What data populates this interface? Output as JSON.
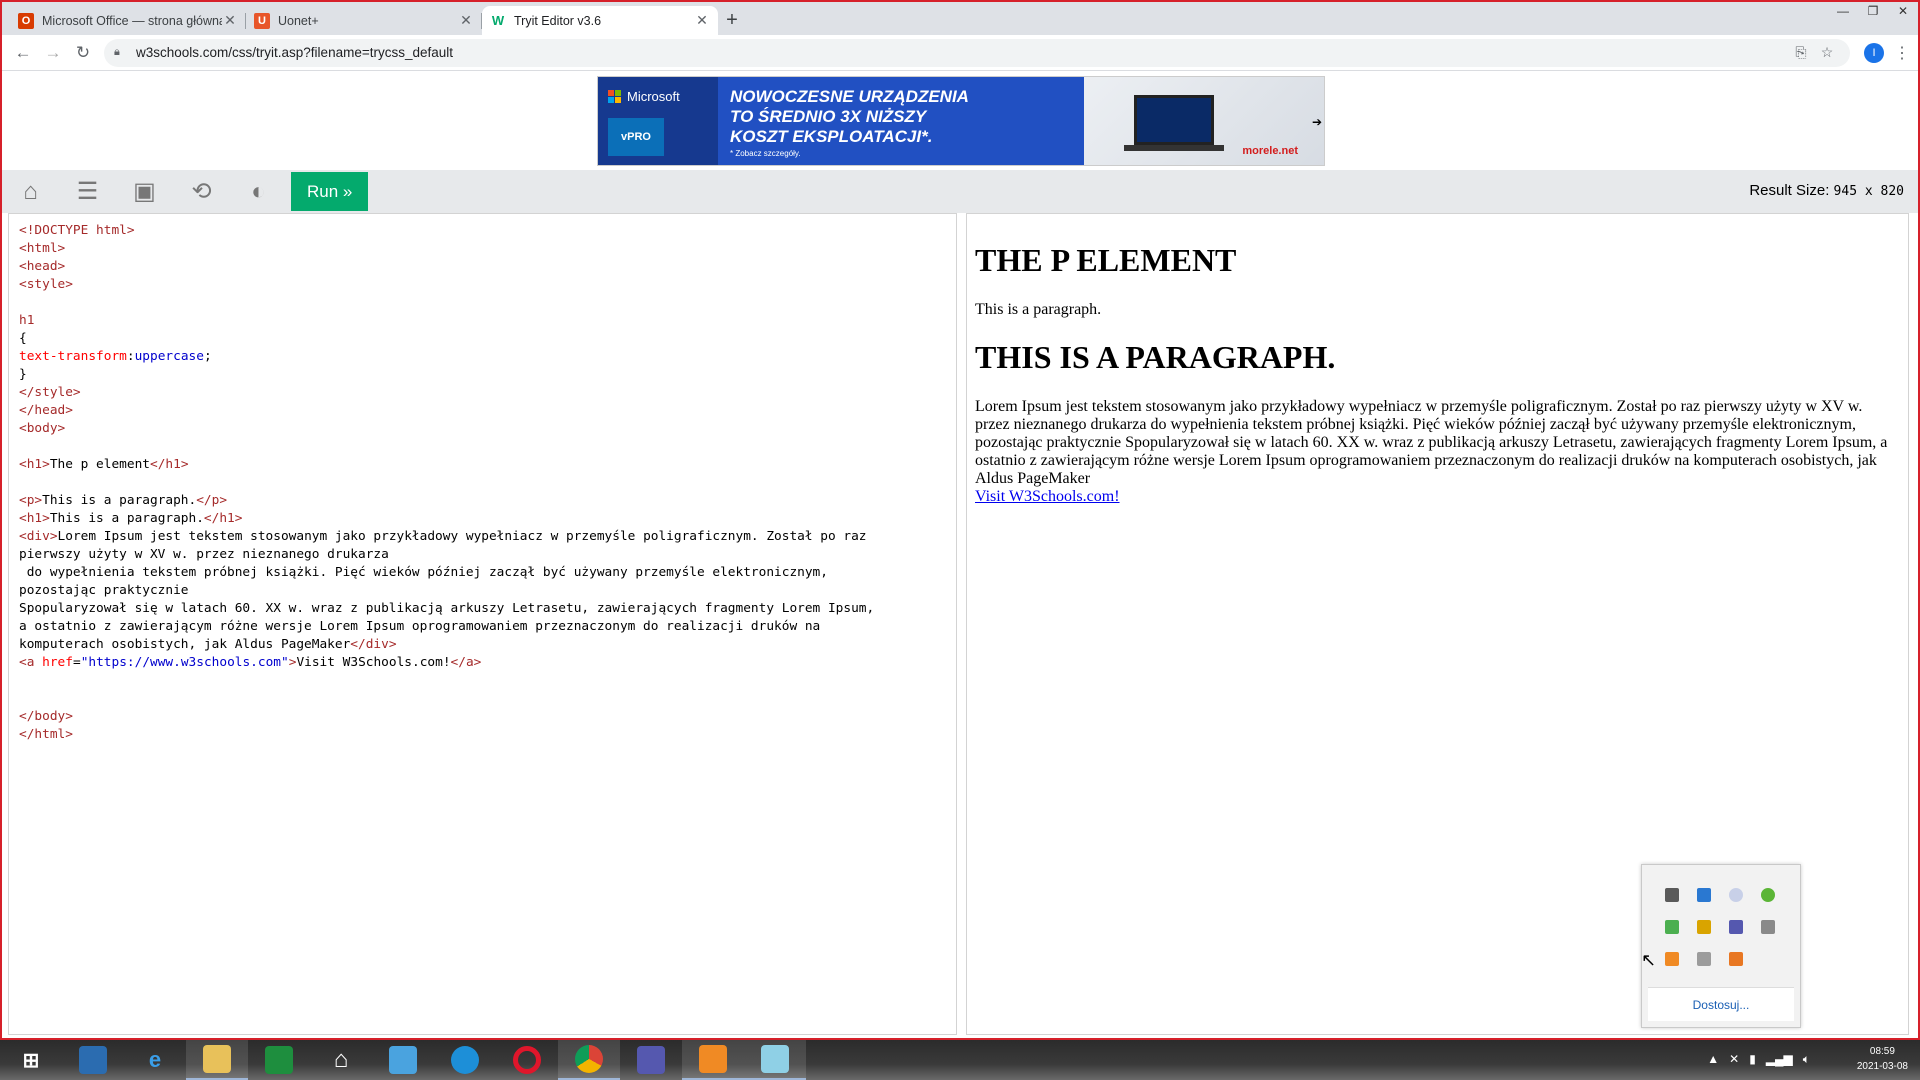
{
  "tabs": [
    {
      "title": "Microsoft Office — strona główna",
      "favicon": "office-icon",
      "color": "#d83b01"
    },
    {
      "title": "Uonet+",
      "favicon": "uonet-icon",
      "color": "#e8562a"
    },
    {
      "title": "Tryit Editor v3.6",
      "favicon": "w3schools-icon",
      "color": "#04aa6d"
    }
  ],
  "address": {
    "url": "w3schools.com/css/tryit.asp?filename=trycss_default",
    "profile_initial": "I"
  },
  "ad": {
    "brand": "Microsoft",
    "badge": "vPRO",
    "headline": [
      "NOWOCZESNE URZĄDZENIA",
      "TO ŚREDNIO 3X NIŻSZY",
      "KOSZT EKSPLOATACJI*."
    ],
    "note": "* Zobacz szczegóły.",
    "partner": "morele.net"
  },
  "toolbar": {
    "run_label": "Run »",
    "result_size_label": "Result Size:",
    "result_size_value": "945 x 820"
  },
  "result": {
    "h1_first": "The p element",
    "paragraph": "This is a paragraph.",
    "h1_second": "This is a paragraph.",
    "lorem": "Lorem Ipsum jest tekstem stosowanym jako przykładowy wypełniacz w przemyśle poligraficznym. Został po raz pierwszy użyty w XV w. przez nieznanego drukarza do wypełnienia tekstem próbnej książki. Pięć wieków później zaczął być używany przemyśle elektronicznym, pozostając praktycznie Spopularyzował się w latach 60. XX w. wraz z publikacją arkuszy Letrasetu, zawierających fragmenty Lorem Ipsum, a ostatnio z zawierającym różne wersje Lorem Ipsum oprogramowaniem przeznaczonym do realizacji druków na komputerach osobistych, jak Aldus PageMaker",
    "link": "Visit W3Schools.com!"
  },
  "tray": {
    "customize_label": "Dostosuj..."
  },
  "clock": {
    "time": "08:59",
    "date": "2021-03-08"
  }
}
